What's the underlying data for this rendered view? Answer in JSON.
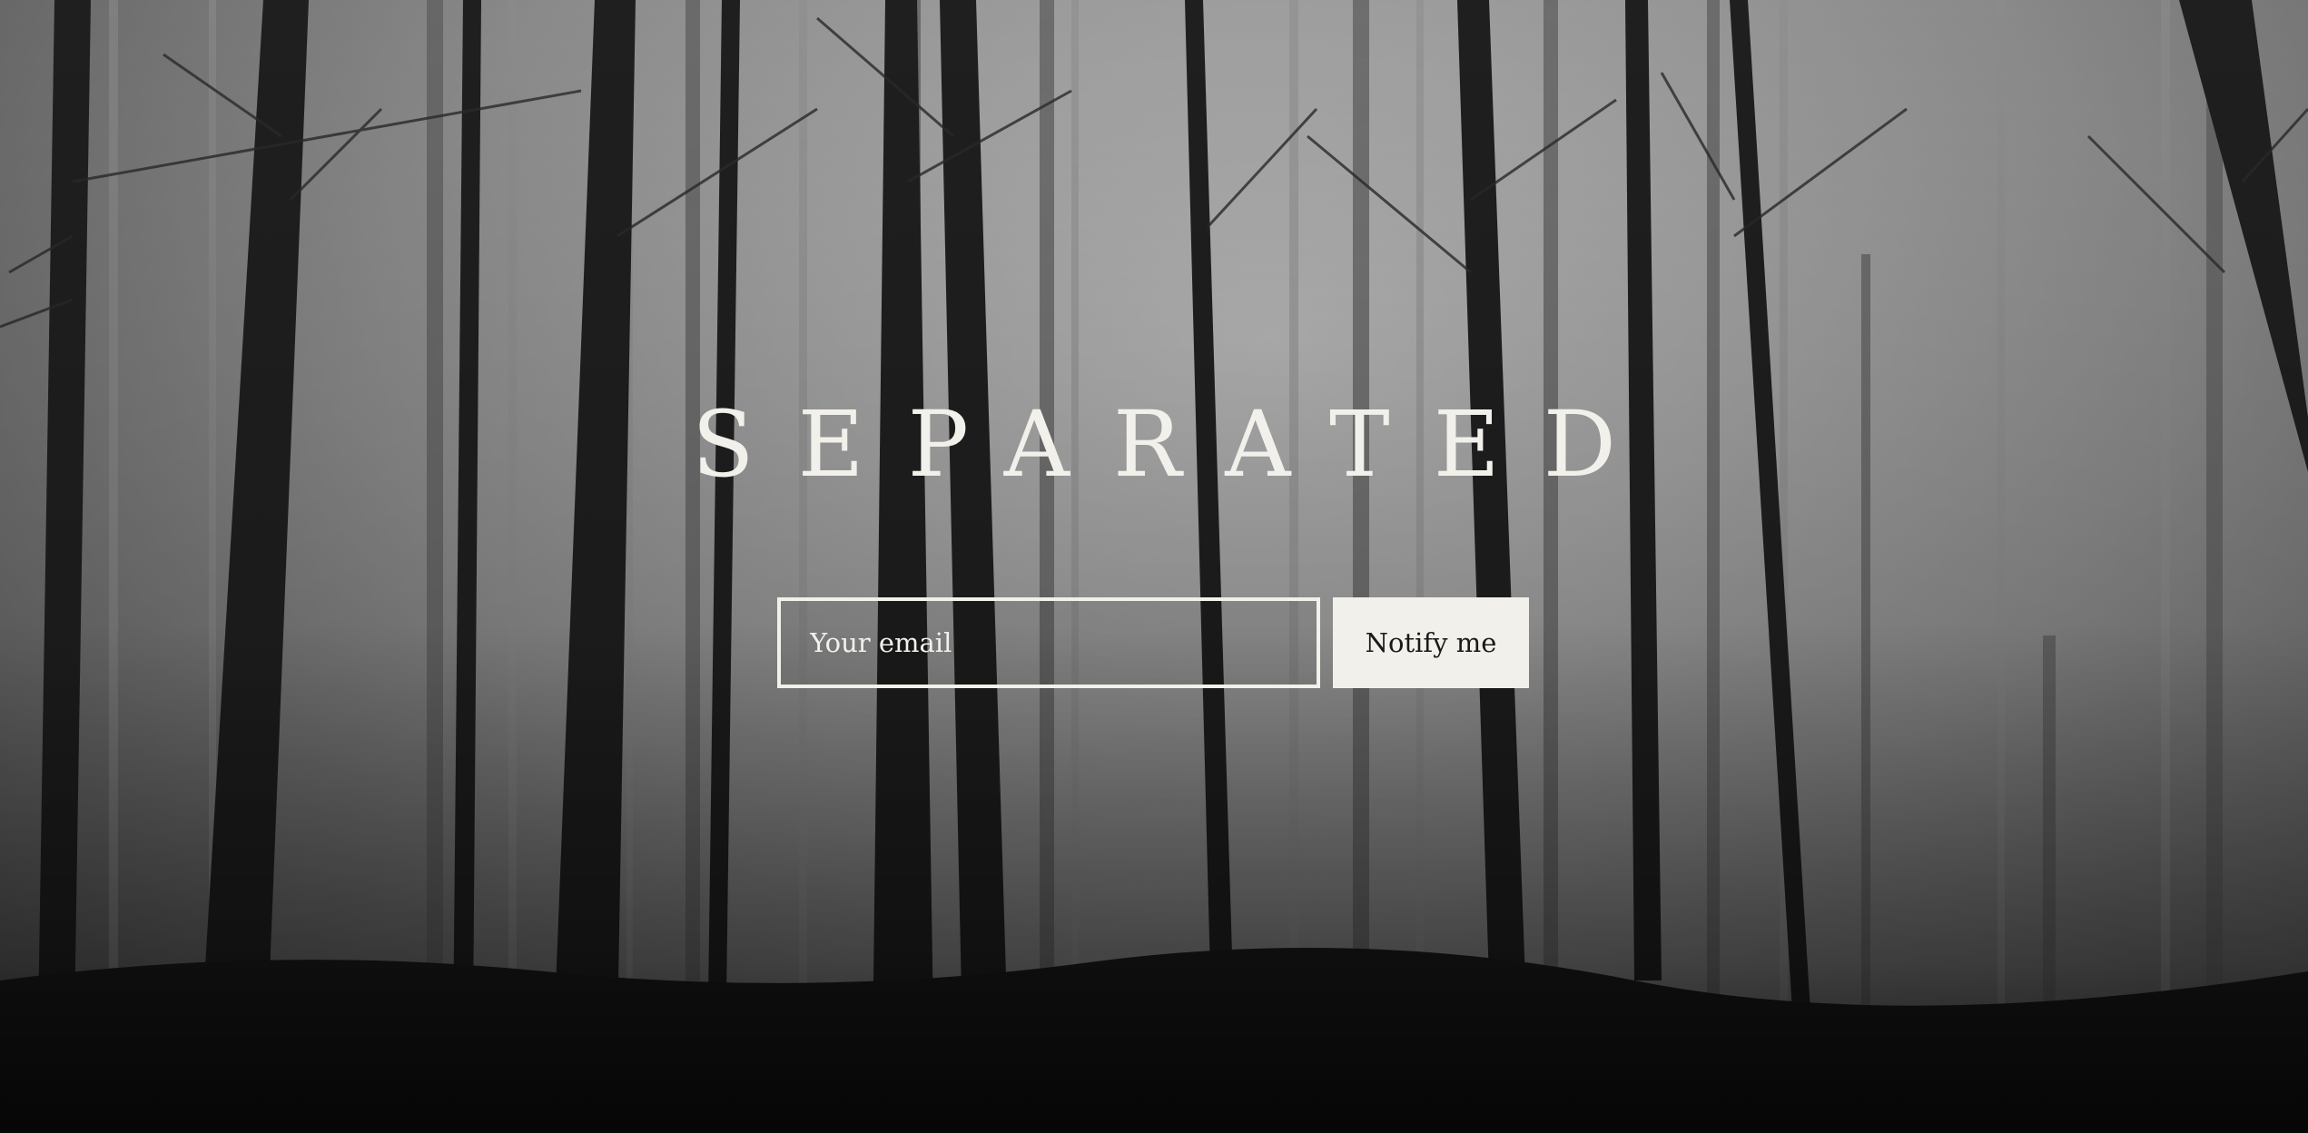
{
  "hero": {
    "title": "SEPARATED",
    "background_image": "foggy-forest-photo"
  },
  "signup": {
    "email_placeholder": "Your email",
    "email_value": "",
    "button_label": "Notify me"
  },
  "colors": {
    "text_light": "#f2f0eb",
    "button_bg": "#f2f0eb",
    "button_text": "#1a1a1a",
    "fog": "#a2a2a2"
  }
}
